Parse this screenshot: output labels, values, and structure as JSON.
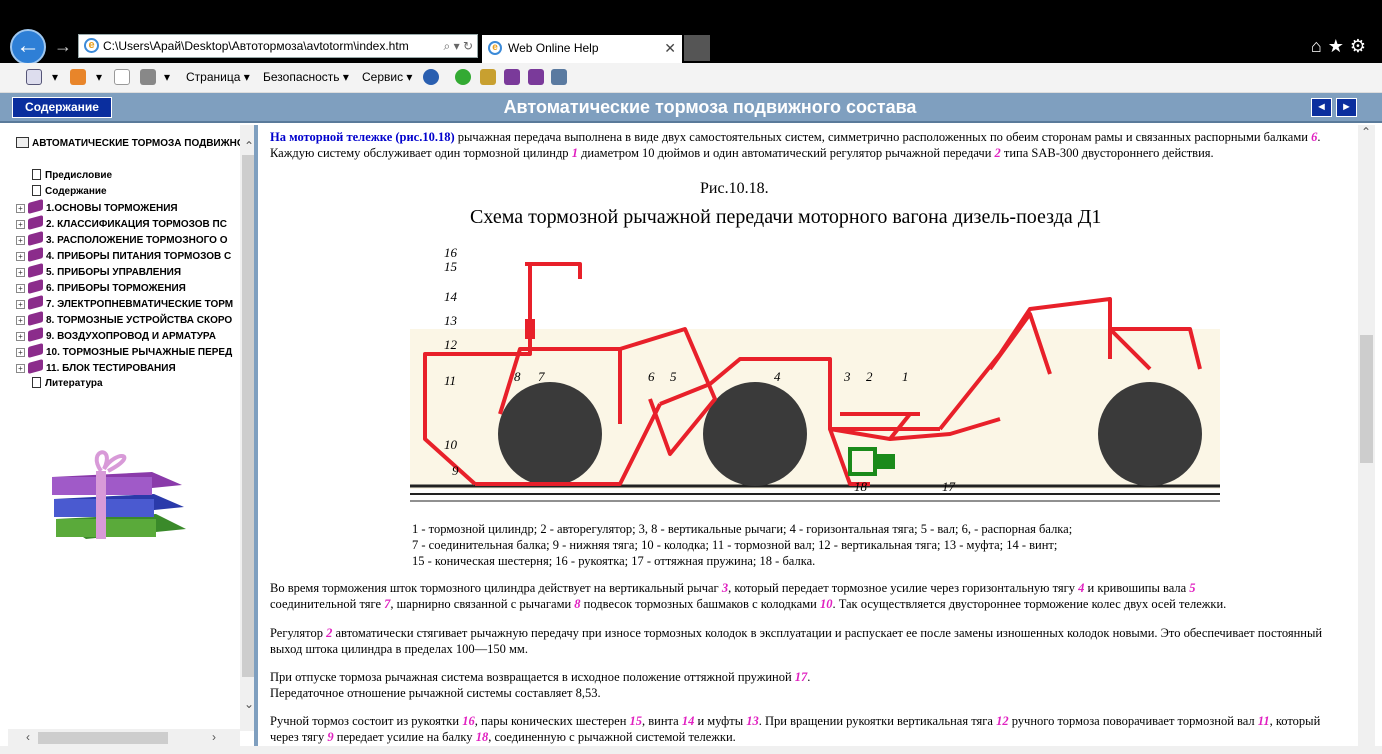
{
  "browser": {
    "address": "C:\\Users\\Арай\\Desktop\\Автотормоза\\avtotorm\\index.htm",
    "tab_title": "Web Online Help",
    "toolbar": {
      "page": "Страница ▾",
      "security": "Безопасность ▾",
      "service": "Сервис ▾"
    }
  },
  "header": {
    "contents_button": "Содержание",
    "title": "Автоматические тормоза подвижного состава",
    "prev": "◄",
    "next": "►"
  },
  "tree": {
    "root": "АВТОМАТИЧЕСКИЕ ТОРМОЗА ПОДВИЖНОГО",
    "items": [
      {
        "label": "Предисловие",
        "type": "page"
      },
      {
        "label": "Содержание",
        "type": "page"
      },
      {
        "label": "1.ОСНОВЫ ТОРМОЖЕНИЯ",
        "type": "book"
      },
      {
        "label": "2. КЛАССИФИКАЦИЯ ТОРМОЗОВ ПС",
        "type": "book"
      },
      {
        "label": "3. РАСПОЛОЖЕНИЕ ТОРМОЗНОГО О",
        "type": "book"
      },
      {
        "label": "4. ПРИБОРЫ ПИТАНИЯ ТОРМОЗОВ С",
        "type": "book"
      },
      {
        "label": "5. ПРИБОРЫ УПРАВЛЕНИЯ",
        "type": "book"
      },
      {
        "label": "6. ПРИБОРЫ ТОРМОЖЕНИЯ",
        "type": "book"
      },
      {
        "label": "7. ЭЛЕКТРОПНЕВМАТИЧЕСКИЕ ТОРМ",
        "type": "book"
      },
      {
        "label": "8. ТОРМОЗНЫЕ УСТРОЙСТВА СКОРО",
        "type": "book"
      },
      {
        "label": "9. ВОЗДУХОПРОВОД И АРМАТУРА",
        "type": "book"
      },
      {
        "label": "10. ТОРМОЗНЫЕ РЫЧАЖНЫЕ ПЕРЕД",
        "type": "book"
      },
      {
        "label": "11. БЛОК ТЕСТИРОВАНИЯ",
        "type": "book"
      },
      {
        "label": "Литература",
        "type": "page"
      }
    ]
  },
  "content": {
    "p1_link": "На моторной тележке (рис.10.18)",
    "p1_a": " рычажная передача выполнена в виде двух самостоятельных систем, симметрично расположенных по обеим сторонам рамы и связанных распорными балками ",
    "p1_n1": "6",
    "p1_b": ". Каждую систему обслуживает один тормозной цилиндр ",
    "p1_n2": "1",
    "p1_c": " диаметром 10 дюймов и один автоматический регулятор рычажной передачи ",
    "p1_n3": "2",
    "p1_d": " типа SAB-300 двустороннего действия.",
    "fig_number": "Рис.10.18.",
    "fig_title": "Схема тормозной рычажной передачи моторного вагона дизель-поезда Д1",
    "legend_1": "1 - тормозной цилиндр; 2 - авторегулятор; 3, 8 - вертикальные рычаги; 4 - горизонтальная тяга; 5 - вал; 6, - распорная балка;",
    "legend_2": "7 - соединительная балка; 9 - нижняя тяга; 10 - колодка; 11 - тормозной вал; 12 - вертикальная тяга; 13 - муфта; 14 - винт;",
    "legend_3": "15 - коническая шестерня; 16 - рукоятка; 17 - оттяжная пружина; 18 - балка.",
    "p2_a": "Во время торможения шток тормозного цилиндра действует на вертикальный рычаг ",
    "p2_n1": "3",
    "p2_b": ", который передает тормозное усилие через горизонтальную тягу ",
    "p2_n2": "4",
    "p2_c": " и кривошипы вала ",
    "p2_n3": "5",
    "p2_d": " соединительной тяге ",
    "p2_n4": "7",
    "p2_e": ", шарнирно связанной с рычагами ",
    "p2_n5": "8",
    "p2_f": " подвесок тормозных башмаков с колодками ",
    "p2_n6": "10",
    "p2_g": ". Так осуществляется двустороннее торможение колес двух осей тележки.",
    "p3_a": "Регулятор ",
    "p3_n1": "2",
    "p3_b": " автоматически стягивает рычажную передачу при износе тормозных колодок в эксплуатации и распускает ее после замены изношенных колодок новыми. Это обеспечивает постоянный выход штока цилиндра в пределах 100—150 мм.",
    "p4_a": "При отпуске тормоза рычажная система возвращается в исходное положение оттяжной пружиной ",
    "p4_n1": "17",
    "p4_b": ".",
    "p4_c": "Передаточное отношение рычажной системы составляет 8,53.",
    "p5_a": "Ручной тормоз состоит из рукоятки ",
    "p5_n1": "16",
    "p5_b": ", пары конических шестерен ",
    "p5_n2": "15",
    "p5_c": ", винта ",
    "p5_n3": "14",
    "p5_d": " и муфты ",
    "p5_n4": "13",
    "p5_e": ". При вращении рукоятки вертикальная тяга ",
    "p5_n5": "12",
    "p5_f": " ручного тормоза поворачивает тормозной вал ",
    "p5_n6": "11",
    "p5_g": ", который через тягу ",
    "p5_n7": "9",
    "p5_h": " передает усилие на балку ",
    "p5_n8": "18",
    "p5_i": ", соединенную с рычажной системой тележки."
  },
  "diagram_labels": [
    "16",
    "15",
    "14",
    "13",
    "12",
    "11",
    "10",
    "9",
    "8",
    "7",
    "6",
    "5",
    "4",
    "3",
    "2",
    "1",
    "18",
    "17"
  ],
  "colors": {
    "accent": "#0a2e9e",
    "header": "#7f9fbf",
    "number": "#e020c0",
    "link": "#0000cc",
    "diagram_red": "#e8202a"
  }
}
